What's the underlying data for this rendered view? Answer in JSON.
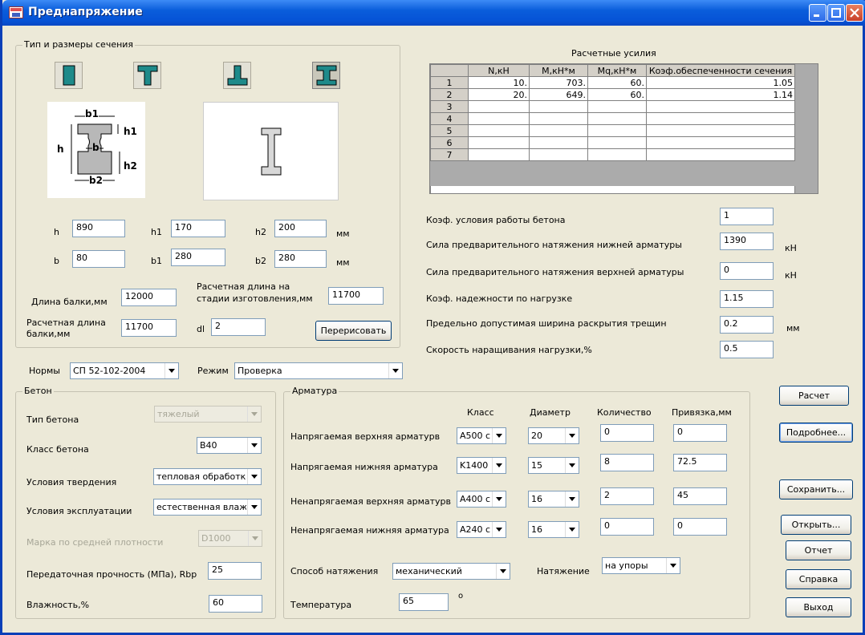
{
  "window": {
    "title": "Преднапряжение"
  },
  "section_group": {
    "legend": "Тип и размеры сечения",
    "labels": {
      "b1": "b1",
      "h1": "h1",
      "h": "h",
      "b": "b",
      "h2": "h2",
      "b2": "b2"
    },
    "fields": {
      "h": {
        "label": "h",
        "value": "890"
      },
      "h1": {
        "label": "h1",
        "value": "170"
      },
      "h2": {
        "label": "h2",
        "value": "200"
      },
      "b": {
        "label": "b",
        "value": "80"
      },
      "b1": {
        "label": "b1",
        "value": "280"
      },
      "b2": {
        "label": "b2",
        "value": "280"
      },
      "unit": "мм"
    },
    "beam_length_label": "Длина балки,мм",
    "beam_length_value": "12000",
    "calc_length_fab_label_1": "Расчетная длина на",
    "calc_length_fab_label_2": "стадии изготовления,мм",
    "calc_length_fab_value": "11700",
    "calc_length_label_1": "Расчетная длина",
    "calc_length_label_2": "балки,мм",
    "calc_length_value": "11700",
    "dl_label": "dl",
    "dl_value": "2",
    "redraw_button": "Перерисовать"
  },
  "norms": {
    "label": "Нормы",
    "value": "СП 52-102-2004"
  },
  "mode": {
    "label": "Режим",
    "value": "Проверка"
  },
  "forces": {
    "title": "Расчетные усилия",
    "columns": [
      "",
      "N,кН",
      "M,кН*м",
      "Mq,кН*м",
      "Коэф.обеспеченности сечения"
    ],
    "rows": [
      {
        "n": "1",
        "N": "10.",
        "M": "703.",
        "Mq": "60.",
        "k": "1.05"
      },
      {
        "n": "2",
        "N": "20.",
        "M": "649.",
        "Mq": "60.",
        "k": "1.14"
      },
      {
        "n": "3",
        "N": "",
        "M": "",
        "Mq": "",
        "k": ""
      },
      {
        "n": "4",
        "N": "",
        "M": "",
        "Mq": "",
        "k": ""
      },
      {
        "n": "5",
        "N": "",
        "M": "",
        "Mq": "",
        "k": ""
      },
      {
        "n": "6",
        "N": "",
        "M": "",
        "Mq": "",
        "k": ""
      },
      {
        "n": "7",
        "N": "",
        "M": "",
        "Mq": "",
        "k": ""
      }
    ]
  },
  "params": {
    "concrete_work_coef": {
      "label": "Коэф. условия работы бетона",
      "value": "1"
    },
    "prestress_bottom": {
      "label": "Сила предварительного натяжения нижней арматуры",
      "value": "1390",
      "unit": "кН"
    },
    "prestress_top": {
      "label": "Сила предварительного натяжения верхней арматуры",
      "value": "0",
      "unit": "кН"
    },
    "load_reliability": {
      "label": "Коэф. надежности по нагрузке",
      "value": "1.15"
    },
    "crack_width": {
      "label": "Предельно допустимая ширина раскрытия трещин",
      "value": "0.2",
      "unit": "мм"
    },
    "load_rate": {
      "label": "Скорость наращивания нагрузки,%",
      "value": "0.5"
    }
  },
  "concrete": {
    "legend": "Бетон",
    "type": {
      "label": "Тип бетона",
      "value": "тяжелый"
    },
    "class": {
      "label": "Класс бетона",
      "value": "B40"
    },
    "hardening": {
      "label": "Условия твердения",
      "value": "тепловая обработк"
    },
    "operation": {
      "label": "Условия эксплуатации",
      "value": "естественная влаж"
    },
    "density": {
      "label": "Марка по средней плотности",
      "value": "D1000"
    },
    "strength": {
      "label": "Передаточная прочность (МПа), Rbp",
      "value": "25"
    },
    "humidity": {
      "label": "Влажность,%",
      "value": "60"
    }
  },
  "rebar": {
    "legend": "Арматура",
    "headers": {
      "class": "Класс",
      "diameter": "Диаметр",
      "count": "Количество",
      "offset": "Привязка,мм"
    },
    "rows": [
      {
        "label": "Напрягаемая верхняя арматурв",
        "class": "A500 с",
        "diameter": "20",
        "count": "0",
        "offset": "0"
      },
      {
        "label": "Напрягаемая нижняя арматура",
        "class": "K1400",
        "diameter": "15",
        "count": "8",
        "offset": "72.5"
      },
      {
        "label": "Ненапрягаемая верхняя арматурв",
        "class": "A400 с",
        "diameter": "16",
        "count": "2",
        "offset": "45"
      },
      {
        "label": "Ненапрягаемая нижняя арматура",
        "class": "A240 с",
        "diameter": "16",
        "count": "0",
        "offset": "0"
      }
    ],
    "tension_method": {
      "label": "Способ натяжения",
      "value": "механический"
    },
    "tension": {
      "label": "Натяжение",
      "value": "на упоры"
    },
    "temperature": {
      "label": "Температура",
      "value": "65",
      "unit": "о"
    }
  },
  "buttons": {
    "calc": "Расчет",
    "details": "Подробнее...",
    "save": "Сохранить...",
    "open": "Открыть...",
    "report": "Отчет",
    "help": "Справка",
    "exit": "Выход"
  }
}
